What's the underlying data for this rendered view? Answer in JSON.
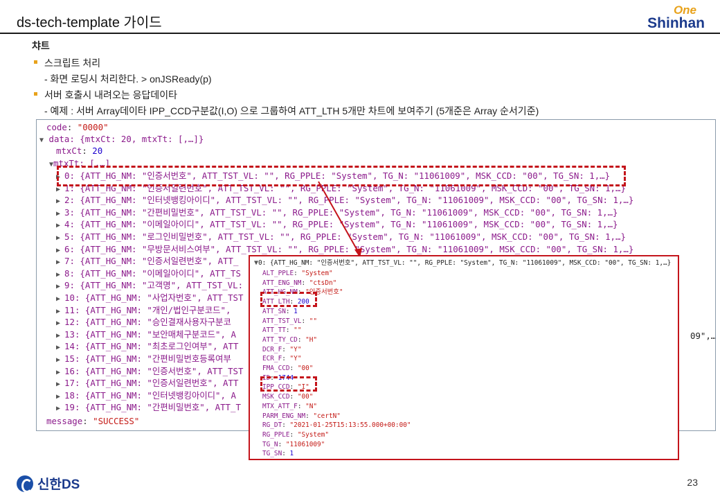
{
  "header": {
    "title": "ds-tech-template 가이드",
    "logo_top": "One",
    "logo_bottom": "Shinhan"
  },
  "section": {
    "heading": "챠트",
    "bullet1": "스크립트 처리",
    "bullet1_sub": "- 화면 로딩시 처리한다. > onJSReady(p)",
    "bullet2": "서버 호출시 내려오는 응답데이타",
    "bullet2_sub": "- 예제 : 서버 Array데이타    IPP_CCD구분값(I,O)  으로  그룹하여 ATT_LTH 5개만 차트에 보여주기 (5개준은 Array 순서기준)"
  },
  "console": {
    "code_key": "code",
    "code_val": "\"0000\"",
    "data_line": "data: {mtxCt: 20, mtxTt: [,…]}",
    "mtxct_key": "mtxCt",
    "mtxct_val": "20",
    "mtxtt_line": "mtxTt: [,…]",
    "rows": [
      "0: {ATT_HG_NM: \"인증서번호\", ATT_TST_VL: \"\", RG_PPLE: \"System\", TG_N: \"11061009\", MSK_CCD: \"00\", TG_SN: 1,…}",
      "1: {ATT_HG_NM: \"인증서일련번호\", ATT_TST_VL: \"\", RG_PPLE: \"System\", TG_N: \"11061009\", MSK_CCD: \"00\", TG_SN: 1,…}",
      "2: {ATT_HG_NM: \"인터넷뱅킹아이디\", ATT_TST_VL: \"\", RG_PPLE: \"System\", TG_N: \"11061009\", MSK_CCD: \"00\", TG_SN: 1,…}",
      "3: {ATT_HG_NM: \"간편비밀번호\", ATT_TST_VL: \"\", RG_PPLE: \"System\", TG_N: \"11061009\", MSK_CCD: \"00\", TG_SN: 1,…}",
      "4: {ATT_HG_NM: \"이메일아이디\", ATT_TST_VL: \"\", RG_PPLE: \"System\", TG_N: \"11061009\", MSK_CCD: \"00\", TG_SN: 1,…}",
      "5: {ATT_HG_NM: \"로그인비밀번호\", ATT_TST_VL: \"\", RG_PPLE: \"System\", TG_N: \"11061009\", MSK_CCD: \"00\", TG_SN: 1,…}",
      "6: {ATT_HG_NM: \"무방문서비스여부\", ATT_TST_VL: \"\", RG_PPLE: \"System\", TG_N: \"11061009\", MSK_CCD: \"00\", TG_SN: 1,…}",
      "7: {ATT_HG_NM: \"인증서일련번호\", ATT_",
      "8: {ATT_HG_NM: \"이메일아이디\", ATT_TS",
      "9: {ATT_HG_NM: \"고객명\", ATT_TST_VL:",
      "10: {ATT_HG_NM: \"사업자번호\", ATT_TST",
      "11: {ATT_HG_NM: \"개인/법인구분코드\",",
      "12: {ATT_HG_NM: \"승인결재사용자구분코",
      "13: {ATT_HG_NM: \"보안매체구분코드\", A",
      "14: {ATT_HG_NM: \"최초로그인여부\", ATT",
      "15: {ATT_HG_NM: \"간편비밀번호등록여부",
      "16: {ATT_HG_NM: \"인증서번호\", ATT_TST",
      "17: {ATT_HG_NM: \"인증서일련번호\", ATT",
      "18: {ATT_HG_NM: \"인터넷뱅킹아이디\", A",
      "19: {ATT_HG_NM: \"간편비밀번호\", ATT_T"
    ],
    "row13_tail": "09\",…}",
    "message_key": "message",
    "message_val": "\"SUCCESS\""
  },
  "popup": {
    "header": "0: {ATT_HG_NM: \"인증서번호\", ATT_TST_VL: \"\", RG_PPLE: \"System\", TG_N: \"11061009\", MSK_CCD: \"00\", TG_SN: 1,…}",
    "fields": [
      {
        "k": "ALT_PPLE",
        "v": "\"System\""
      },
      {
        "k": "ATT_ENG_NM",
        "v": "\"ctsDn\""
      },
      {
        "k": "ATT_HG_NM",
        "v": "\"인증서번호\""
      },
      {
        "k": "ATT_LTH",
        "v": "200"
      },
      {
        "k": "ATT_SN",
        "v": "1"
      },
      {
        "k": "ATT_TST_VL",
        "v": "\"\""
      },
      {
        "k": "ATT_TT",
        "v": "\"\""
      },
      {
        "k": "ATT_TY_CD",
        "v": "\"H\""
      },
      {
        "k": "DCR_F",
        "v": "\"Y\""
      },
      {
        "k": "ECR_F",
        "v": "\"Y\""
      },
      {
        "k": "FMA_CCD",
        "v": "\"00\""
      },
      {
        "k": "ID",
        "v": "1744"
      },
      {
        "k": "IPP_CCD",
        "v": "\"I\""
      },
      {
        "k": "MSK_CCD",
        "v": "\"00\""
      },
      {
        "k": "MTX_ATT_F",
        "v": "\"N\""
      },
      {
        "k": "PARM_ENG_NM",
        "v": "\"certN\""
      },
      {
        "k": "RG_DT",
        "v": "\"2021-01-25T15:13:55.000+00:00\""
      },
      {
        "k": "RG_PPLE",
        "v": "\"System\""
      },
      {
        "k": "TG_N",
        "v": "\"11061009\""
      },
      {
        "k": "TG_SN",
        "v": "1"
      }
    ]
  },
  "footer": {
    "brand": "신한DS",
    "page": "23"
  },
  "colors": {
    "accent_red": "#c4141b",
    "bullet_orange": "#e8a21b",
    "brand_blue": "#1b3a8c"
  }
}
